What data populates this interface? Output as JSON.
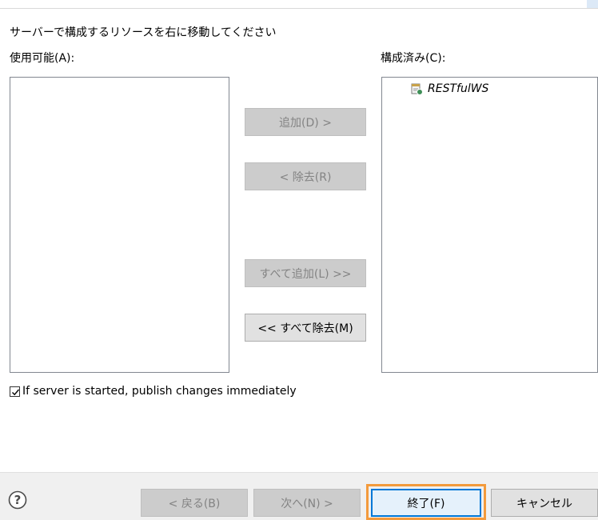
{
  "dialog": {
    "instruction": "サーバーで構成するリソースを右に移動してください",
    "available_label": "使用可能(A):",
    "configured_label": "構成済み(C):",
    "configured_items": [
      {
        "label": "RESTfulWS",
        "icon": "web-project-icon"
      }
    ],
    "buttons": {
      "add": "追加(D) >",
      "remove": "< 除去(R)",
      "add_all": "すべて追加(L) >>",
      "remove_all": "<< すべて除去(M)"
    },
    "publish_checkbox": {
      "label": "If server is started, publish changes immediately",
      "checked": true
    }
  },
  "footer": {
    "help_icon": "help-icon",
    "back": "< 戻る(B)",
    "next": "次へ(N) >",
    "finish": "終了(F)",
    "cancel": "キャンセル"
  },
  "colors": {
    "highlight_frame": "#f39a3c",
    "disabled_button": "#cccccc",
    "default_button_border": "#0078d7"
  }
}
